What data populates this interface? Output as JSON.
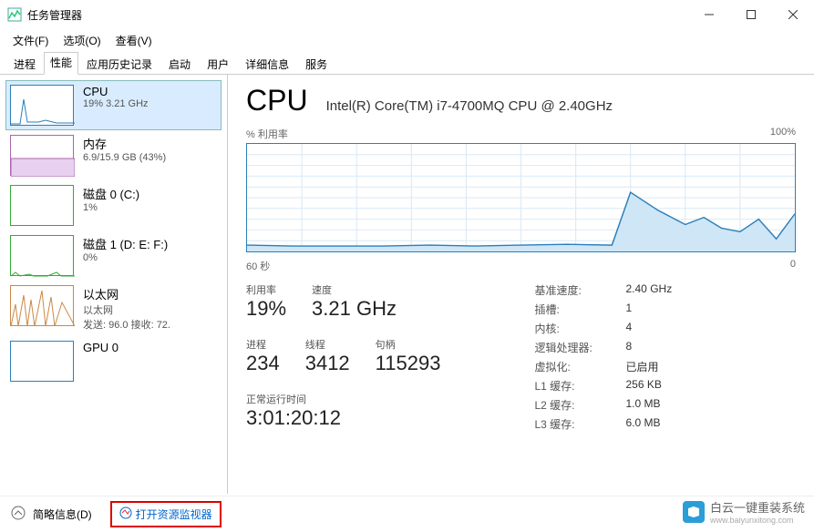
{
  "window": {
    "title": "任务管理器"
  },
  "menu": {
    "file": "文件(F)",
    "options": "选项(O)",
    "view": "查看(V)"
  },
  "tabs": [
    "进程",
    "性能",
    "应用历史记录",
    "启动",
    "用户",
    "详细信息",
    "服务"
  ],
  "sidebar": [
    {
      "name": "CPU",
      "stat": "19% 3.21 GHz"
    },
    {
      "name": "内存",
      "stat": "6.9/15.9 GB (43%)"
    },
    {
      "name": "磁盘 0 (C:)",
      "stat": "1%"
    },
    {
      "name": "磁盘 1 (D: E: F:)",
      "stat": "0%"
    },
    {
      "name": "以太网",
      "stat": "以太网",
      "extra": "发送: 96.0  接收: 72."
    },
    {
      "name": "GPU 0",
      "stat": ""
    }
  ],
  "main": {
    "title": "CPU",
    "sub": "Intel(R) Core(TM) i7-4700MQ CPU @ 2.40GHz",
    "chart_label": "% 利用率",
    "chart_max": "100%",
    "chart_time": "60 秒",
    "chart_zero": "0",
    "stats": [
      {
        "label": "利用率",
        "value": "19%"
      },
      {
        "label": "速度",
        "value": "3.21 GHz"
      }
    ],
    "stats2": [
      {
        "label": "进程",
        "value": "234"
      },
      {
        "label": "线程",
        "value": "3412"
      },
      {
        "label": "句柄",
        "value": "115293"
      }
    ],
    "uptime": {
      "label": "正常运行时间",
      "value": "3:01:20:12"
    },
    "info": [
      {
        "k": "基准速度:",
        "v": "2.40 GHz"
      },
      {
        "k": "插槽:",
        "v": "1"
      },
      {
        "k": "内核:",
        "v": "4"
      },
      {
        "k": "逻辑处理器:",
        "v": "8"
      },
      {
        "k": "虚拟化:",
        "v": "已启用"
      },
      {
        "k": "L1 缓存:",
        "v": "256 KB"
      },
      {
        "k": "L2 缓存:",
        "v": "1.0 MB"
      },
      {
        "k": "L3 缓存:",
        "v": "6.0 MB"
      }
    ]
  },
  "footer": {
    "brief": "简略信息(D)",
    "rm": "打开资源监视器"
  },
  "watermark": {
    "text": "白云一键重装系统",
    "url": "www.baiyunxitong.com"
  },
  "chart_data": {
    "type": "line",
    "title": "% 利用率",
    "xlabel": "60 秒",
    "ylabel": "",
    "ylim": [
      0,
      100
    ],
    "x_seconds_ago": [
      60,
      55,
      50,
      45,
      40,
      35,
      30,
      25,
      20,
      18,
      15,
      12,
      10,
      8,
      6,
      4,
      2,
      0
    ],
    "values": [
      6,
      5,
      5,
      5,
      6,
      5,
      6,
      7,
      6,
      55,
      38,
      25,
      32,
      22,
      18,
      30,
      12,
      35
    ]
  }
}
